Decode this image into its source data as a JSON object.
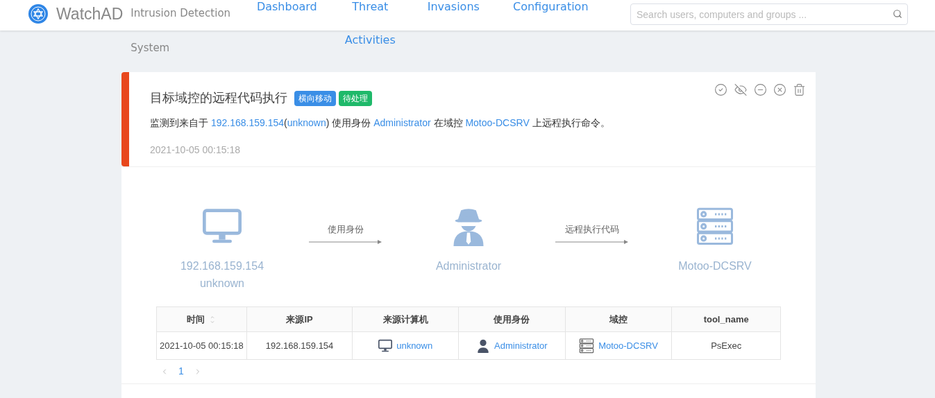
{
  "header": {
    "logo_text": "WatchAD",
    "subtitle": "Intrusion Detection System",
    "nav": [
      {
        "label": "Dashboard"
      },
      {
        "label": "Threat Activities"
      },
      {
        "label": "Invasions"
      },
      {
        "label": "Configuration"
      }
    ],
    "search": {
      "placeholder": "Search users, computers and groups ..."
    }
  },
  "alert": {
    "title": "目标域控的远程代码执行",
    "tags": [
      {
        "label": "横向移动",
        "color": "#3a8ee6"
      },
      {
        "label": "待处理",
        "color": "#1fb96a"
      }
    ],
    "description": [
      {
        "kind": "text",
        "text": "监测到来自于 "
      },
      {
        "kind": "link",
        "text": "192.168.159.154"
      },
      {
        "kind": "text",
        "text": "("
      },
      {
        "kind": "link",
        "text": "unknown"
      },
      {
        "kind": "text",
        "text": ") 使用身份 "
      },
      {
        "kind": "link",
        "text": "Administrator"
      },
      {
        "kind": "text",
        "text": " 在域控 "
      },
      {
        "kind": "link",
        "text": "Motoo-DCSRV"
      },
      {
        "kind": "text",
        "text": " 上远程执行命令。"
      }
    ],
    "time": "2021-10-05 00:15:18"
  },
  "diagram": {
    "nodes": [
      {
        "kind": "computer",
        "lines": [
          "192.168.159.154",
          "unknown"
        ]
      },
      {
        "kind": "user",
        "lines": [
          "Administrator"
        ]
      },
      {
        "kind": "server",
        "lines": [
          "Motoo-DCSRV"
        ]
      }
    ],
    "edges": [
      "使用身份",
      "远程执行代码"
    ]
  },
  "table": {
    "columns": [
      {
        "label": "时间",
        "sortable": true
      },
      {
        "label": "来源IP",
        "sortable": false
      },
      {
        "label": "来源计算机",
        "sortable": false
      },
      {
        "label": "使用身份",
        "sortable": false
      },
      {
        "label": "域控",
        "sortable": false
      },
      {
        "label": "tool_name",
        "sortable": false
      }
    ],
    "rows": [
      {
        "cells": [
          {
            "kind": "text",
            "text": "2021-10-05 00:15:18"
          },
          {
            "kind": "text",
            "text": "192.168.159.154"
          },
          {
            "kind": "computer",
            "text": "unknown"
          },
          {
            "kind": "user",
            "text": "Administrator"
          },
          {
            "kind": "server",
            "text": "Motoo-DCSRV"
          },
          {
            "kind": "text",
            "text": "PsExec"
          }
        ]
      }
    ]
  },
  "pagination": {
    "pages": [
      {
        "label": "1",
        "selected": true
      }
    ]
  }
}
